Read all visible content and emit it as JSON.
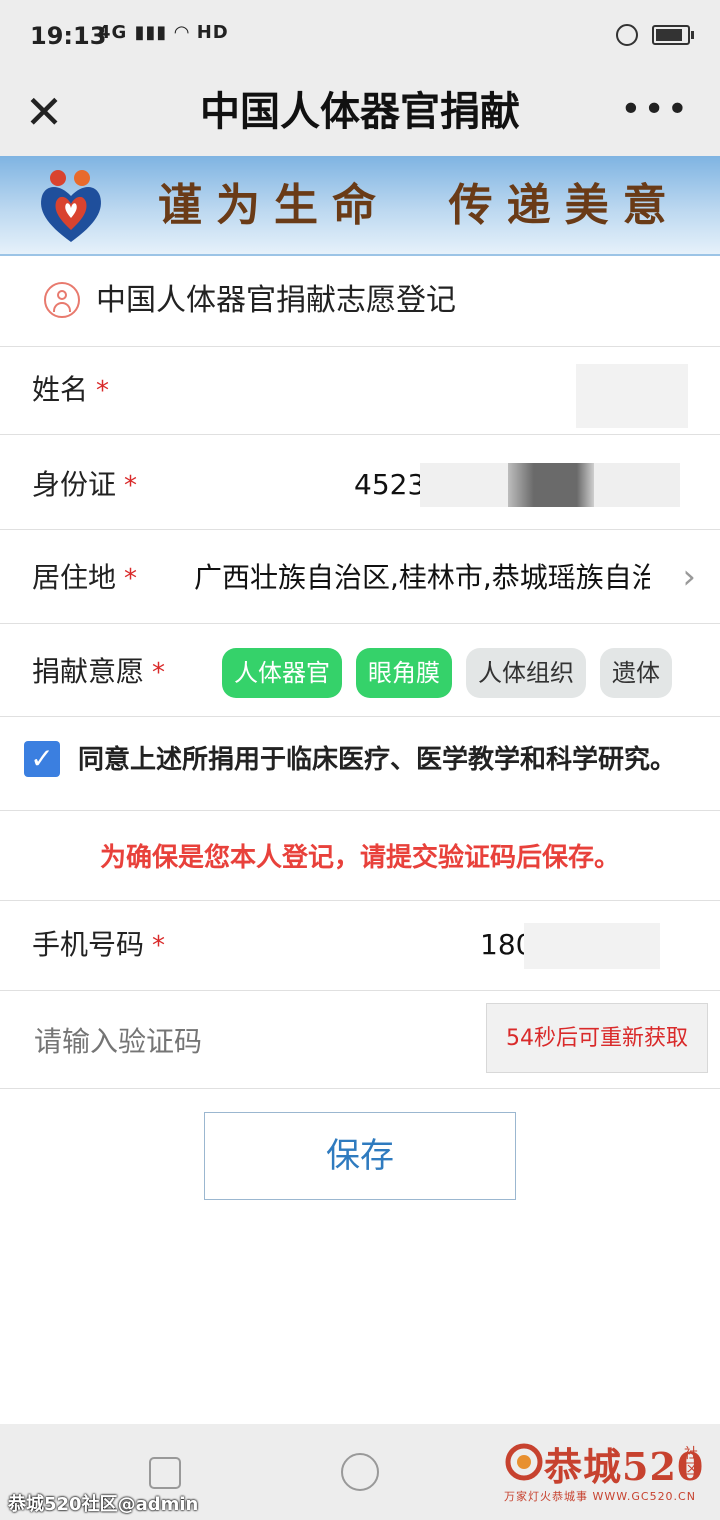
{
  "status_bar": {
    "time": "19:13",
    "network": "4G",
    "hd": "HD"
  },
  "nav": {
    "close_glyph": "✕",
    "title": "中国人体器官捐献",
    "more_glyph": "•••"
  },
  "banner": {
    "slogan": "谨为生命  传递美意"
  },
  "form": {
    "section_title": "中国人体器官捐献志愿登记",
    "name_label": "姓名",
    "id_label": "身份证",
    "id_value_visible": "4523",
    "address_label": "居住地",
    "address_value": "广西壮族自治区,桂林市,恭城瑶族自治",
    "wish_label": "捐献意愿",
    "required_mark": "*",
    "wish_options": [
      {
        "label": "人体器官",
        "selected": true
      },
      {
        "label": "眼角膜",
        "selected": true
      },
      {
        "label": "人体组织",
        "selected": false
      },
      {
        "label": "遗体",
        "selected": false
      }
    ],
    "consent_text": "同意上述所捐用于临床医疗、医学教学和科学研究。",
    "consent_checked": true,
    "notice": "为确保是您本人登记，请提交验证码后保存。",
    "phone_label": "手机号码",
    "phone_value_visible": "180",
    "code_placeholder": "请输入验证码",
    "resend_label": "54秒后可重新获取",
    "save_label": "保存"
  },
  "watermark": {
    "user": "恭城520社区@admin",
    "brand": "恭城520",
    "region": "社区",
    "sub": "万家灯火恭城事 WWW.GC520.CN"
  },
  "colors": {
    "accent_green": "#35d26a",
    "required_red": "#d92a2a",
    "notice_red": "#e8413b",
    "checkbox_blue": "#3b7fe0",
    "save_text_blue": "#2f7bbf"
  }
}
